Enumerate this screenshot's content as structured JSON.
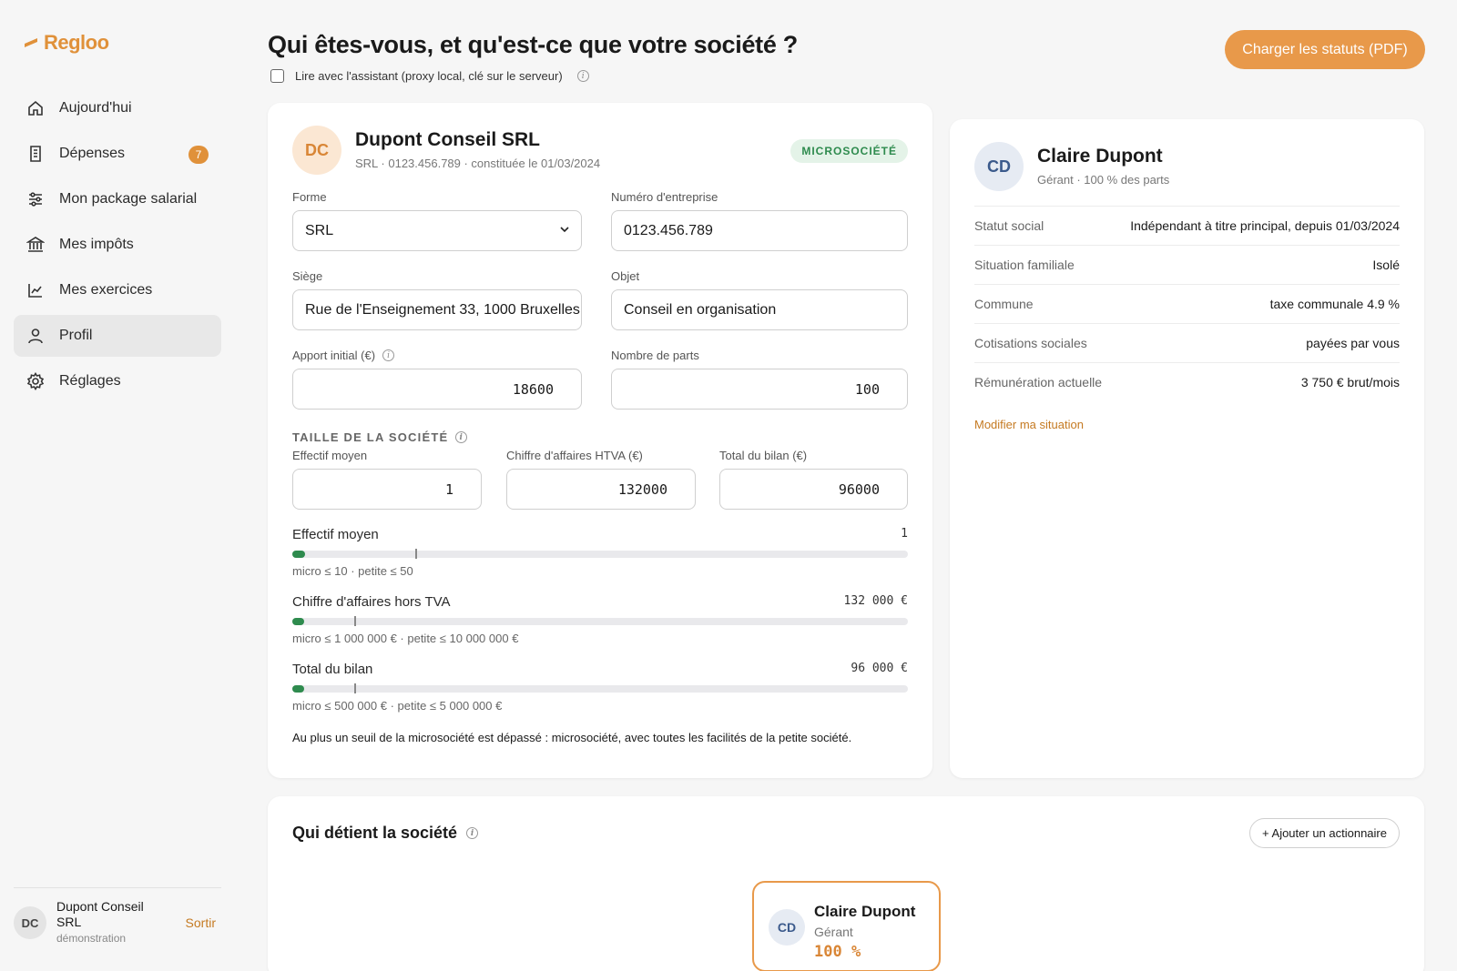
{
  "brand": {
    "name": "Regloo",
    "accent": "#e0913a"
  },
  "sidebar": {
    "items": [
      {
        "label": "Aujourd'hui",
        "icon": "home-icon"
      },
      {
        "label": "Dépenses",
        "icon": "receipt-icon",
        "badge": "7"
      },
      {
        "label": "Mon package salarial",
        "icon": "sliders-icon"
      },
      {
        "label": "Mes impôts",
        "icon": "bank-icon"
      },
      {
        "label": "Mes exercices",
        "icon": "chart-line-icon"
      },
      {
        "label": "Profil",
        "icon": "user-icon",
        "active": true
      },
      {
        "label": "Réglages",
        "icon": "gear-icon"
      }
    ],
    "footer": {
      "initials": "DC",
      "company": "Dupont Conseil SRL",
      "mode": "démonstration",
      "logout": "Sortir"
    }
  },
  "header": {
    "title": "Qui êtes-vous, et qu'est-ce que votre société ?",
    "assistant_label": "Lire avec l'assistant (proxy local, clé sur le serveur)",
    "assistant_checked": false,
    "upload_button": "Charger les statuts (PDF)"
  },
  "company": {
    "initials": "DC",
    "name": "Dupont Conseil SRL",
    "subtitle": "SRL · 0123.456.789 · constituée le 01/03/2024",
    "badge": "MICROSOCIÉTÉ",
    "fields": {
      "forme": {
        "label": "Forme",
        "value": "SRL"
      },
      "numero": {
        "label": "Numéro d'entreprise",
        "value": "0123.456.789"
      },
      "siege": {
        "label": "Siège",
        "value": "Rue de l'Enseignement 33, 1000 Bruxelles"
      },
      "objet": {
        "label": "Objet",
        "value": "Conseil en organisation"
      },
      "apport": {
        "label": "Apport initial (€)",
        "value": "18600"
      },
      "parts": {
        "label": "Nombre de parts",
        "value": "100"
      }
    },
    "size_section": {
      "title": "TAILLE DE LA SOCIÉTÉ",
      "effectif": {
        "label": "Effectif moyen",
        "value": "1"
      },
      "ca": {
        "label": "Chiffre d'affaires HTVA (€)",
        "value": "132000"
      },
      "bilan": {
        "label": "Total du bilan (€)",
        "value": "96000"
      }
    },
    "meters": [
      {
        "label": "Effectif moyen",
        "display": "1",
        "note": "micro ≤ 10 · petite ≤ 50",
        "value": 1,
        "micro": 10,
        "max": 50
      },
      {
        "label": "Chiffre d'affaires hors TVA",
        "display": "132 000 €",
        "note": "micro ≤ 1 000 000 € · petite ≤ 10 000 000 €",
        "value": 132000,
        "micro": 1000000,
        "max": 10000000
      },
      {
        "label": "Total du bilan",
        "display": "96 000 €",
        "note": "micro ≤ 500 000 € · petite ≤ 5 000 000 €",
        "value": 96000,
        "micro": 500000,
        "max": 5000000
      }
    ],
    "verdict": "Au plus un seuil de la microsociété est dépassé : microsociété, avec toutes les facilités de la petite société."
  },
  "person": {
    "initials": "CD",
    "name": "Claire Dupont",
    "subtitle": "Gérant · 100 % des parts",
    "rows": [
      {
        "key": "Statut social",
        "value": "Indépendant à titre principal, depuis 01/03/2024"
      },
      {
        "key": "Situation familiale",
        "value": "Isolé"
      },
      {
        "key": "Commune",
        "value": "taxe communale 4.9 %"
      },
      {
        "key": "Cotisations sociales",
        "value": "payées par vous"
      },
      {
        "key": "Rémunération actuelle",
        "value": "3 750 € brut/mois"
      }
    ],
    "edit_link": "Modifier ma situation"
  },
  "owners": {
    "title": "Qui détient la société",
    "add_button": "+ Ajouter un actionnaire",
    "list": [
      {
        "initials": "CD",
        "name": "Claire Dupont",
        "role": "Gérant",
        "share": "100 %"
      }
    ]
  }
}
